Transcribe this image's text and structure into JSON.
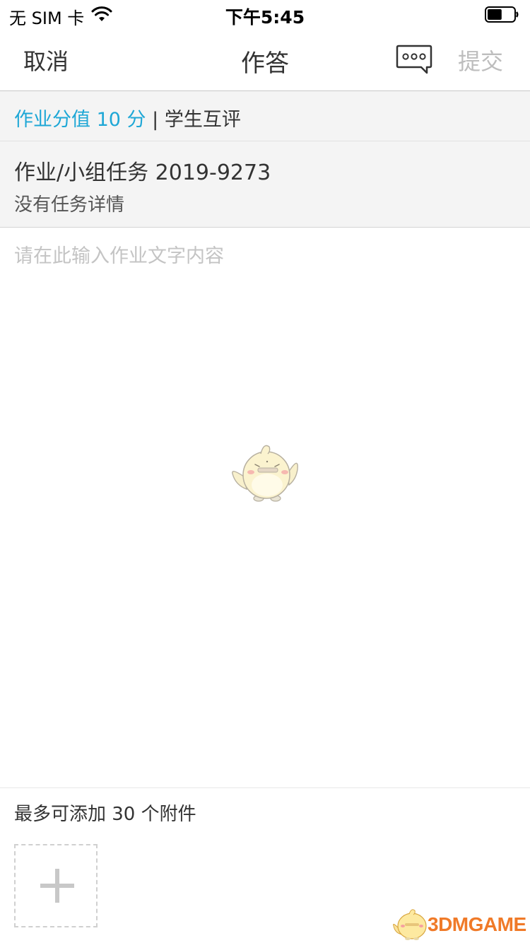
{
  "status_bar": {
    "carrier": "无 SIM 卡",
    "time": "下午5:45",
    "wifi_icon": "wifi-icon",
    "battery_icon": "battery-icon",
    "battery_level": 0.55
  },
  "nav": {
    "cancel": "取消",
    "title": "作答",
    "comment_icon": "chat-bubble-icon",
    "submit": "提交"
  },
  "assignment": {
    "score_text": "作业分值 10 分",
    "separator": "|",
    "mode": "学生互评",
    "title": "作业/小组任务 2019-9273",
    "detail": "没有任务详情"
  },
  "answer": {
    "placeholder": "请在此输入作业文字内容"
  },
  "attachments": {
    "limit_text": "最多可添加 30 个附件",
    "add_icon": "plus-icon"
  },
  "watermark": {
    "text": "3DMGAME"
  },
  "colors": {
    "accent": "#1ea7d6",
    "submit_disabled": "#bdbdbd",
    "info_bg": "#f4f4f4",
    "watermark": "#f07a28"
  }
}
